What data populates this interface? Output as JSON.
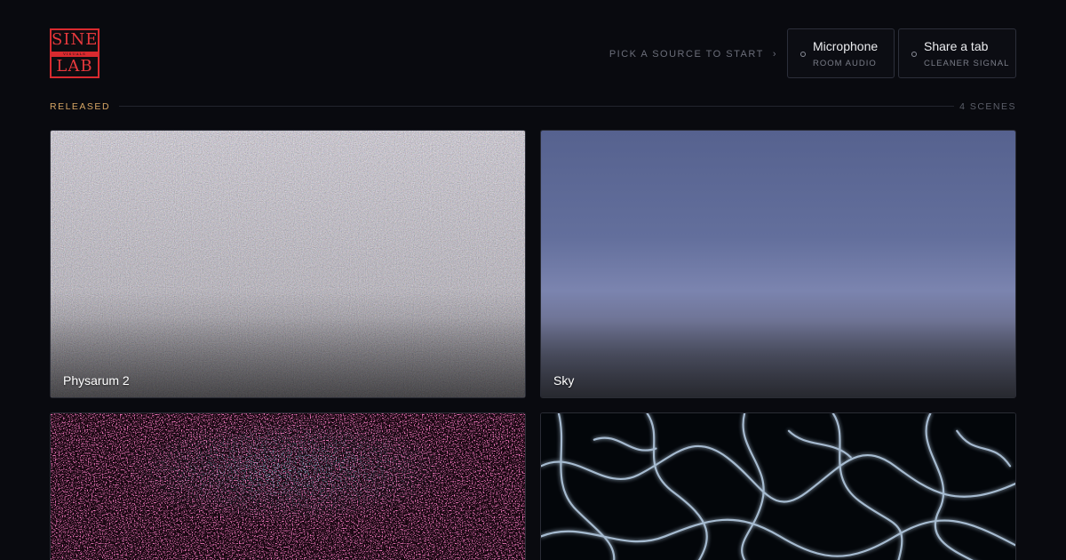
{
  "brand": {
    "logo_top": "SINE",
    "logo_band": "VISUALS",
    "logo_bottom": "LAB",
    "accent_color": "#d92a2f"
  },
  "header": {
    "prompt": "PICK A SOURCE TO START",
    "prompt_icon": "chevron-right-icon",
    "sources": [
      {
        "title": "Microphone",
        "subtitle": "ROOM AUDIO",
        "icon": "radio-circle-icon"
      },
      {
        "title": "Share a tab",
        "subtitle": "CLEANER SIGNAL",
        "icon": "radio-circle-icon"
      }
    ]
  },
  "section": {
    "label": "RELEASED",
    "count": "4 SCENES",
    "label_color": "#d6a564"
  },
  "scenes": [
    {
      "label": "Physarum 2"
    },
    {
      "label": "Sky"
    },
    {
      "label": ""
    },
    {
      "label": ""
    }
  ]
}
